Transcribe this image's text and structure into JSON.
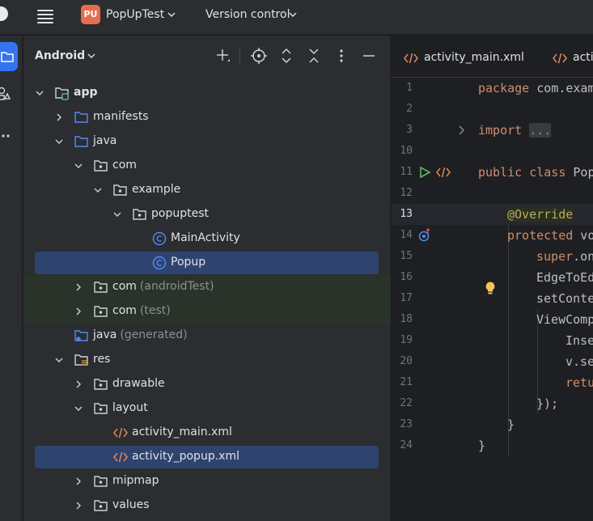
{
  "titlebar": {
    "project_initials": "PU",
    "project_name": "PopUpTest",
    "version_control": "Version control"
  },
  "panel": {
    "title": "Android"
  },
  "tree": [
    {
      "label": "app",
      "sub": "",
      "icon": "module-folder-icon"
    },
    {
      "label": "manifests",
      "sub": "",
      "icon": "folder-icon"
    },
    {
      "label": "java",
      "sub": "",
      "icon": "folder-icon"
    },
    {
      "label": "com",
      "sub": "",
      "icon": "package-icon"
    },
    {
      "label": "example",
      "sub": "",
      "icon": "package-icon"
    },
    {
      "label": "popuptest",
      "sub": "",
      "icon": "package-icon"
    },
    {
      "label": "MainActivity",
      "sub": "",
      "icon": "class-icon"
    },
    {
      "label": "Popup",
      "sub": "",
      "icon": "class-icon"
    },
    {
      "label": "com",
      "sub": "(androidTest)",
      "icon": "package-icon"
    },
    {
      "label": "com",
      "sub": "(test)",
      "icon": "package-icon"
    },
    {
      "label": "java",
      "sub": "(generated)",
      "icon": "generated-folder-icon"
    },
    {
      "label": "res",
      "sub": "",
      "icon": "resource-folder-icon"
    },
    {
      "label": "drawable",
      "sub": "",
      "icon": "package-icon"
    },
    {
      "label": "layout",
      "sub": "",
      "icon": "package-icon"
    },
    {
      "label": "activity_main.xml",
      "sub": "",
      "icon": "xml-file-icon"
    },
    {
      "label": "activity_popup.xml",
      "sub": "",
      "icon": "xml-file-icon"
    },
    {
      "label": "mipmap",
      "sub": "",
      "icon": "package-icon"
    },
    {
      "label": "values",
      "sub": "",
      "icon": "package-icon"
    }
  ],
  "tabs": [
    {
      "label": "activity_main.xml"
    },
    {
      "label": "activi"
    }
  ],
  "editor": {
    "current_line": 13,
    "line_numbers": [
      "1",
      "2",
      "3",
      "10",
      "11",
      "12",
      "13",
      "14",
      "15",
      "16",
      "17",
      "18",
      "19",
      "20",
      "21",
      "22",
      "23",
      "24"
    ],
    "code": {
      "l1_kw": "package",
      "l1_rest": " com.exam",
      "l3_kw": "import",
      "l3_fold": "...",
      "l11_kw": "public class",
      "l11_rest": " Pop",
      "l13_ann": "@Override",
      "l14_kw": "protected",
      "l14_rest": " vo",
      "l15_kw": "super",
      "l15_rest": ".on",
      "l16": "EdgeToEd",
      "l17": "setConte",
      "l18": "ViewComp",
      "l19": "Inse",
      "l20": "v.se",
      "l21_kw": "retu",
      "l22": "});",
      "l23": "}",
      "l24": "}"
    }
  },
  "colors": {
    "accent": "#3574f0",
    "selection": "#2e436e",
    "keyword": "#cf8e6d",
    "annotation": "#b3ae60",
    "folder": "#548af7"
  }
}
